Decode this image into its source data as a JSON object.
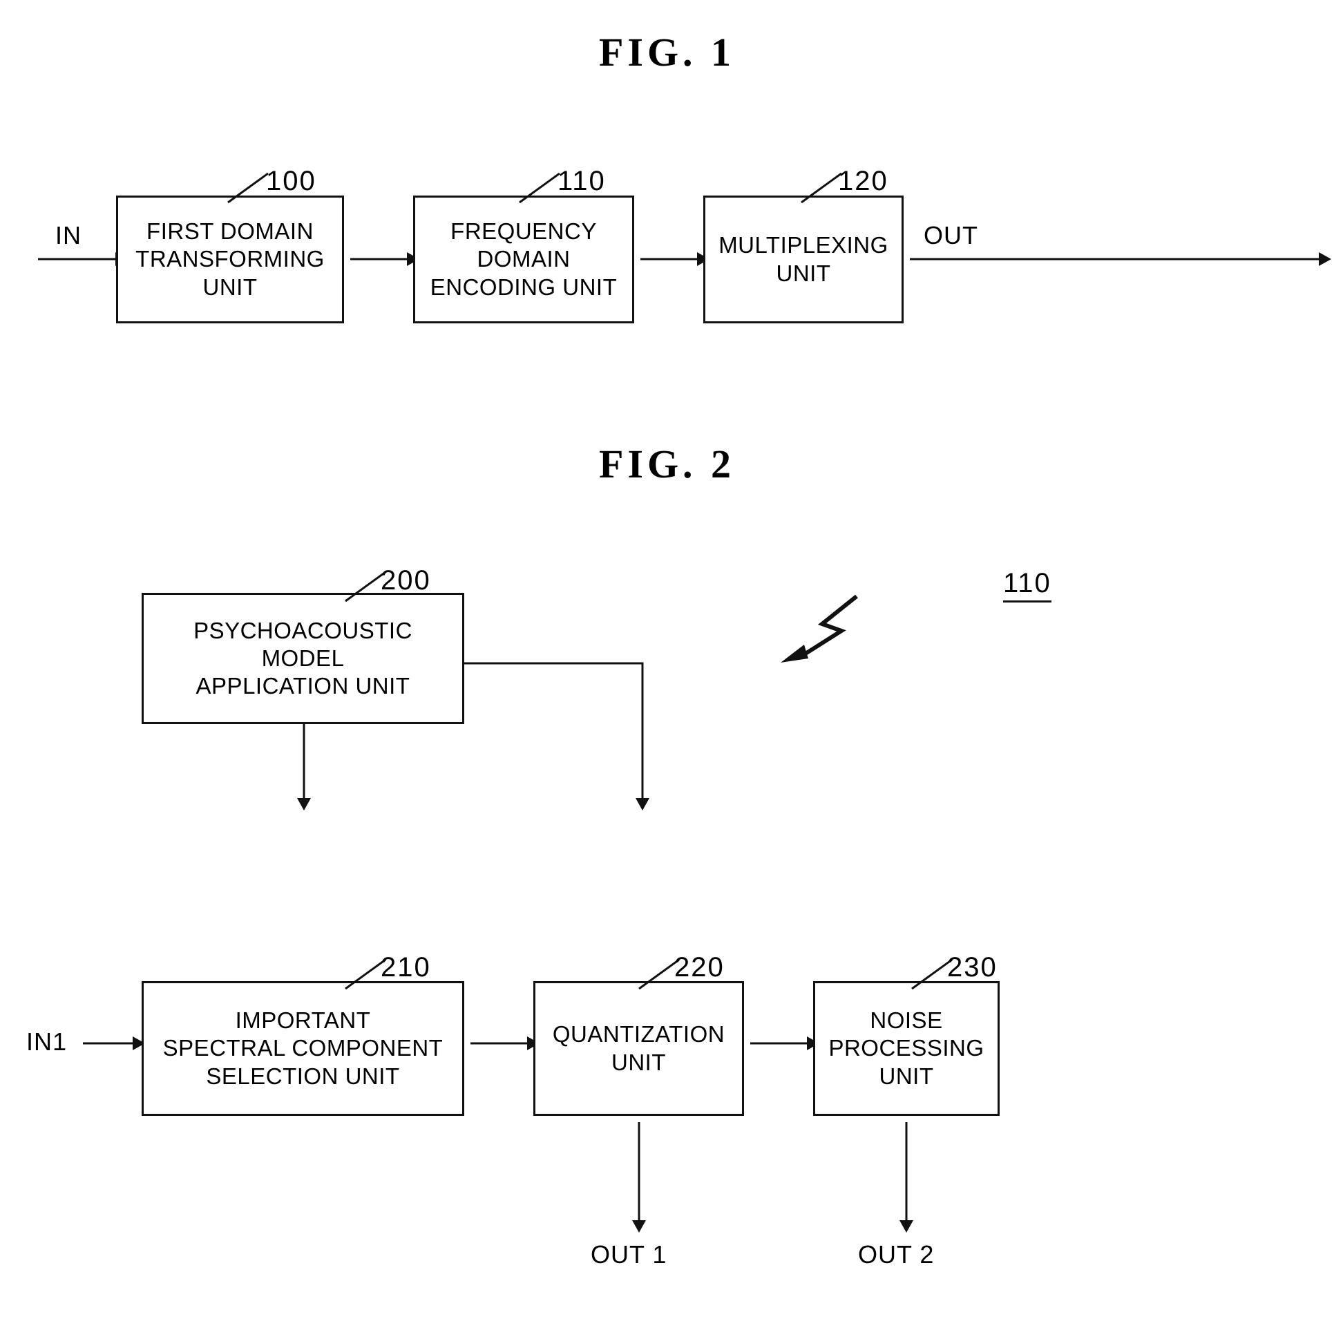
{
  "figures": [
    {
      "title": "FIG.  1",
      "blocks": [
        {
          "ref": "100",
          "label": "FIRST DOMAIN\nTRANSFORMING\nUNIT"
        },
        {
          "ref": "110",
          "label": "FREQUENCY\nDOMAIN\nENCODING UNIT"
        },
        {
          "ref": "120",
          "label": "MULTIPLEXING\nUNIT"
        }
      ],
      "signals": [
        {
          "name": "input",
          "label": "IN"
        },
        {
          "name": "output",
          "label": "OUT"
        }
      ]
    },
    {
      "title": "FIG.  2",
      "callout_ref": "110",
      "blocks": [
        {
          "ref": "200",
          "label": "PSYCHOACOUSTIC\nMODEL\nAPPLICATION UNIT"
        },
        {
          "ref": "210",
          "label": "IMPORTANT\nSPECTRAL COMPONENT\nSELECTION UNIT"
        },
        {
          "ref": "220",
          "label": "QUANTIZATION\nUNIT"
        },
        {
          "ref": "230",
          "label": "NOISE\nPROCESSING\nUNIT"
        }
      ],
      "signals": [
        {
          "name": "input-1",
          "label": "IN1"
        },
        {
          "name": "output-1",
          "label": "OUT 1"
        },
        {
          "name": "output-2",
          "label": "OUT 2"
        }
      ]
    }
  ]
}
